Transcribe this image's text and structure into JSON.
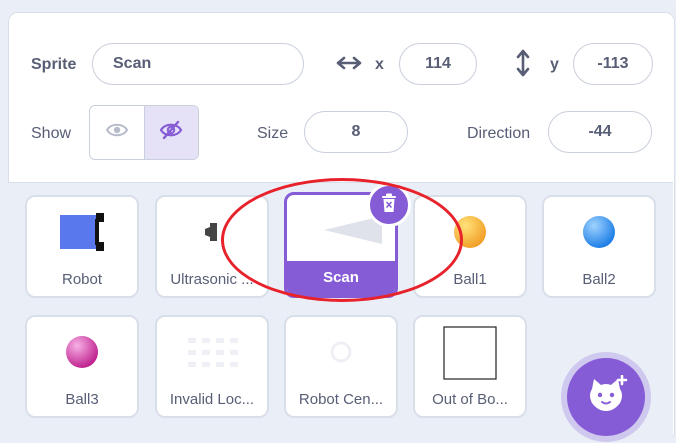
{
  "sprite_info": {
    "sprite_label": "Sprite",
    "sprite_name": "Scan",
    "x_label": "x",
    "x_value": "114",
    "y_label": "y",
    "y_value": "-113",
    "show_label": "Show",
    "size_label": "Size",
    "size_value": "8",
    "direction_label": "Direction",
    "direction_value": "-44",
    "visible_selected": "hidden"
  },
  "sprites": [
    {
      "name": "Robot",
      "thumb": "robot-icon"
    },
    {
      "name": "Ultrasonic ...",
      "thumb": "sensor-icon"
    },
    {
      "name": "Scan",
      "thumb": "scan-cone-icon",
      "selected": true
    },
    {
      "name": "Ball1",
      "thumb": "orange-ball-icon"
    },
    {
      "name": "Ball2",
      "thumb": "blue-ball-icon"
    },
    {
      "name": "Ball3",
      "thumb": "pink-ball-icon"
    },
    {
      "name": "Invalid Loc...",
      "thumb": "invalid-location-icon"
    },
    {
      "name": "Robot Cen...",
      "thumb": "robot-center-icon"
    },
    {
      "name": "Out of Bo...",
      "thumb": "square-outline-icon"
    }
  ],
  "colors": {
    "accent": "#855cd6",
    "highlight": "#e8222b",
    "text": "#575e75"
  }
}
